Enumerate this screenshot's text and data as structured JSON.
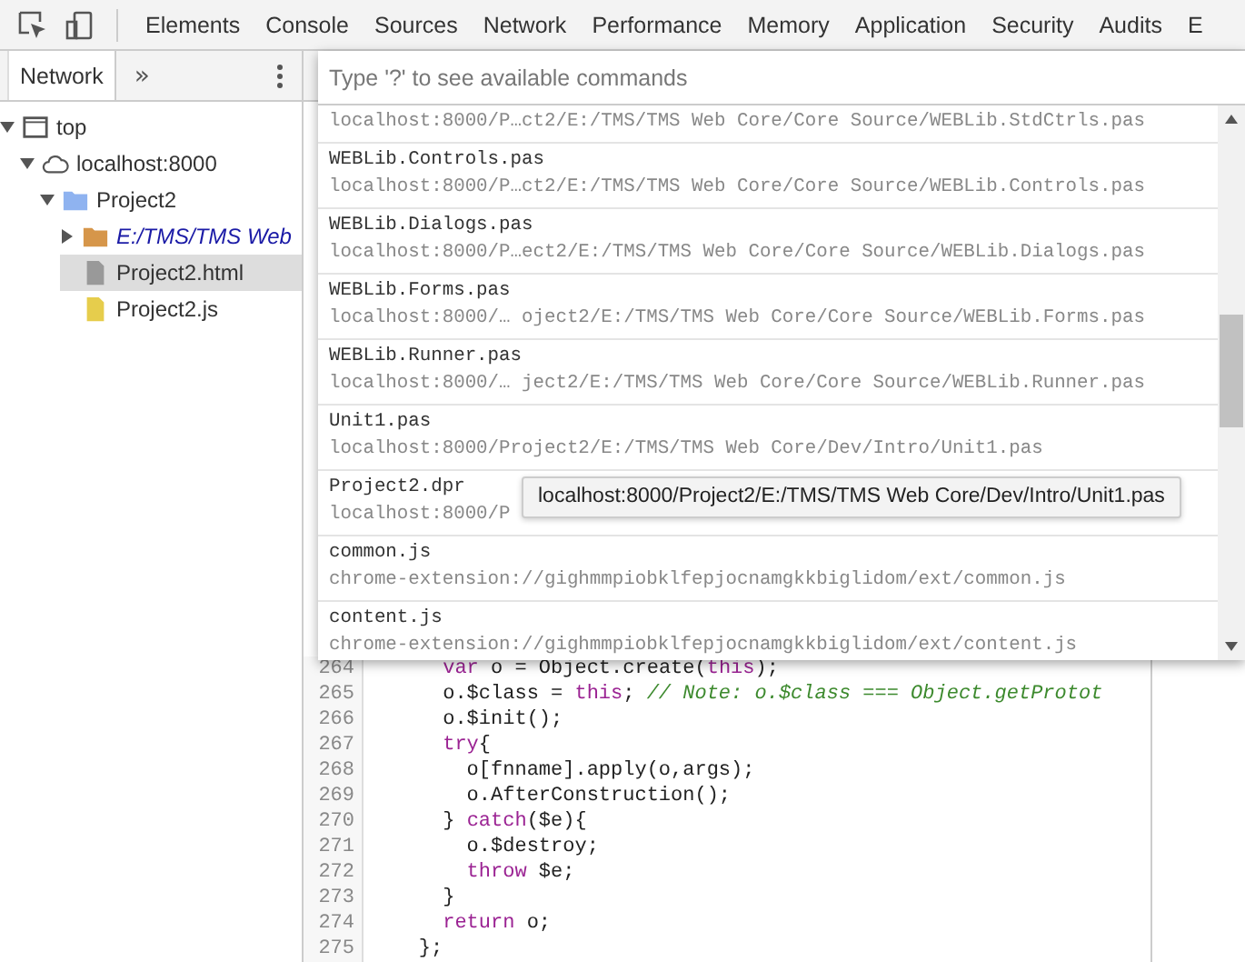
{
  "toolbar": {
    "tabs": [
      "Elements",
      "Console",
      "Sources",
      "Network",
      "Performance",
      "Memory",
      "Application",
      "Security",
      "Audits",
      "E"
    ]
  },
  "sidebar": {
    "tab": "Network",
    "more": "»",
    "tree": [
      {
        "label": "top",
        "kind": "frame",
        "expanded": true,
        "selected": false,
        "children": [
          {
            "label": "localhost:8000",
            "kind": "origin",
            "expanded": true,
            "selected": false,
            "children": [
              {
                "label": "Project2",
                "kind": "folder",
                "expanded": true,
                "selected": false,
                "children": [
                  {
                    "label": "E:/TMS/TMS Web",
                    "kind": "mapped",
                    "expanded": false,
                    "selected": false
                  },
                  {
                    "label": "Project2.html",
                    "kind": "document",
                    "selected": true
                  },
                  {
                    "label": "Project2.js",
                    "kind": "script",
                    "selected": false
                  }
                ]
              }
            ]
          }
        ]
      }
    ]
  },
  "command_menu": {
    "placeholder": "Type '?' to see available commands",
    "items": [
      {
        "path": "localhost:8000/P…ct2/E:/TMS/TMS Web Core/Core Source/WEBLib.StdCtrls.pas"
      },
      {
        "name": "WEBLib.Controls.pas",
        "path": "localhost:8000/P…ct2/E:/TMS/TMS Web Core/Core Source/WEBLib.Controls.pas"
      },
      {
        "name": "WEBLib.Dialogs.pas",
        "path": "localhost:8000/P…ect2/E:/TMS/TMS Web Core/Core Source/WEBLib.Dialogs.pas"
      },
      {
        "name": "WEBLib.Forms.pas",
        "path": "localhost:8000/… oject2/E:/TMS/TMS Web Core/Core Source/WEBLib.Forms.pas"
      },
      {
        "name": "WEBLib.Runner.pas",
        "path": "localhost:8000/… ject2/E:/TMS/TMS Web Core/Core Source/WEBLib.Runner.pas"
      },
      {
        "name": "Unit1.pas",
        "path": "localhost:8000/Project2/E:/TMS/TMS Web Core/Dev/Intro/Unit1.pas"
      },
      {
        "name": "Project2.dpr",
        "path": "localhost:8000/P",
        "tooltip": "localhost:8000/Project2/E:/TMS/TMS Web Core/Dev/Intro/Unit1.pas"
      },
      {
        "name": "common.js",
        "path": "chrome-extension://gighmmpiobklfepjocnamgkkbiglidom/ext/common.js"
      },
      {
        "name": "content.js",
        "path": "chrome-extension://gighmmpiobklfepjocnamgkkbiglidom/ext/content.js"
      }
    ]
  },
  "editor": {
    "lines": [
      {
        "number": "264",
        "segments": [
          {
            "kind": "keyword",
            "text": "      var"
          },
          {
            "kind": "plain",
            "text": " o = Object.create("
          },
          {
            "kind": "keyword",
            "text": "this"
          },
          {
            "kind": "plain",
            "text": ");"
          }
        ]
      },
      {
        "number": "265",
        "segments": [
          {
            "kind": "plain",
            "text": "      o.$class = "
          },
          {
            "kind": "keyword",
            "text": "this"
          },
          {
            "kind": "plain",
            "text": "; "
          },
          {
            "kind": "comment",
            "text": "// Note: o.$class === Object.getProtot"
          }
        ]
      },
      {
        "number": "266",
        "segments": [
          {
            "kind": "plain",
            "text": "      o.$init();"
          }
        ]
      },
      {
        "number": "267",
        "segments": [
          {
            "kind": "keyword",
            "text": "      try"
          },
          {
            "kind": "plain",
            "text": "{"
          }
        ]
      },
      {
        "number": "268",
        "segments": [
          {
            "kind": "plain",
            "text": "        o[fnname].apply(o,args);"
          }
        ]
      },
      {
        "number": "269",
        "segments": [
          {
            "kind": "plain",
            "text": "        o.AfterConstruction();"
          }
        ]
      },
      {
        "number": "270",
        "segments": [
          {
            "kind": "plain",
            "text": "      } "
          },
          {
            "kind": "keyword",
            "text": "catch"
          },
          {
            "kind": "plain",
            "text": "($e){"
          }
        ]
      },
      {
        "number": "271",
        "segments": [
          {
            "kind": "plain",
            "text": "        o.$destroy;"
          }
        ]
      },
      {
        "number": "272",
        "segments": [
          {
            "kind": "keyword",
            "text": "        throw"
          },
          {
            "kind": "plain",
            "text": " $e;"
          }
        ]
      },
      {
        "number": "273",
        "segments": [
          {
            "kind": "plain",
            "text": "      }"
          }
        ]
      },
      {
        "number": "274",
        "segments": [
          {
            "kind": "keyword",
            "text": "      return"
          },
          {
            "kind": "plain",
            "text": " o;"
          }
        ]
      },
      {
        "number": "275",
        "segments": [
          {
            "kind": "plain",
            "text": "    };"
          }
        ]
      }
    ]
  }
}
